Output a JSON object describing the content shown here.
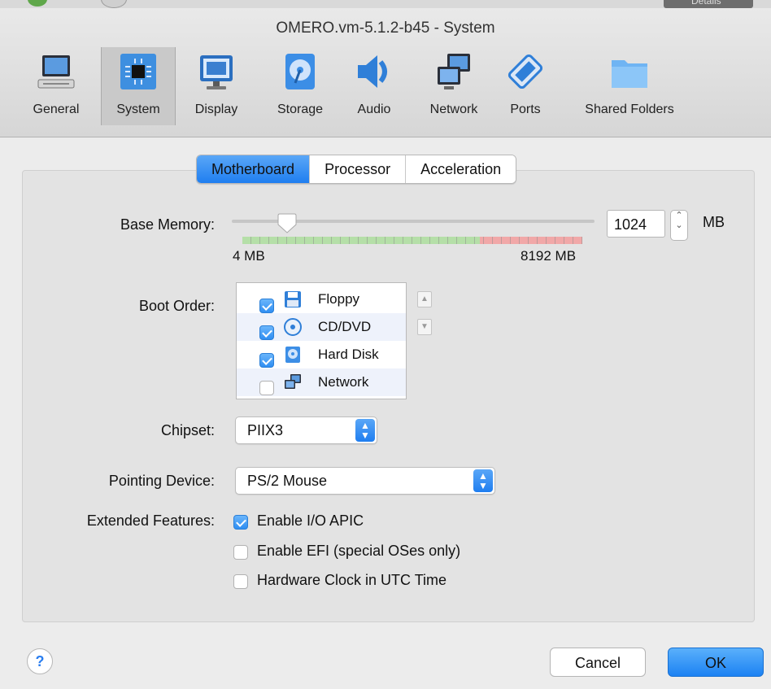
{
  "window": {
    "title": "OMERO.vm-5.1.2-b45 - System",
    "background_details_label": "Details"
  },
  "toolbar": {
    "items": [
      {
        "label": "General",
        "icon": "monitor-icon"
      },
      {
        "label": "System",
        "icon": "chip-icon",
        "selected": true
      },
      {
        "label": "Display",
        "icon": "display-icon"
      },
      {
        "label": "Storage",
        "icon": "disk-icon"
      },
      {
        "label": "Audio",
        "icon": "speaker-icon"
      },
      {
        "label": "Network",
        "icon": "network-icon"
      },
      {
        "label": "Ports",
        "icon": "plug-icon"
      },
      {
        "label": "Shared Folders",
        "icon": "folder-icon"
      }
    ]
  },
  "tabs": [
    {
      "label": "Motherboard",
      "active": true
    },
    {
      "label": "Processor"
    },
    {
      "label": "Acceleration"
    }
  ],
  "base_memory": {
    "label": "Base Memory:",
    "value": "1024",
    "unit": "MB",
    "min_label": "4 MB",
    "max_label": "8192 MB",
    "slider_fraction": 0.125
  },
  "boot_order": {
    "label": "Boot Order:",
    "items": [
      {
        "label": "Floppy",
        "checked": true,
        "icon": "floppy-icon"
      },
      {
        "label": "CD/DVD",
        "checked": true,
        "icon": "cd-icon"
      },
      {
        "label": "Hard Disk",
        "checked": true,
        "icon": "hard-disk-icon"
      },
      {
        "label": "Network",
        "checked": false,
        "icon": "network-icon"
      }
    ]
  },
  "chipset": {
    "label": "Chipset:",
    "value": "PIIX3"
  },
  "pointing_device": {
    "label": "Pointing Device:",
    "value": "PS/2 Mouse"
  },
  "extended_features": {
    "label": "Extended Features:",
    "items": [
      {
        "label": "Enable I/O APIC",
        "checked": true
      },
      {
        "label": "Enable EFI (special OSes only)",
        "checked": false
      },
      {
        "label": "Hardware Clock in UTC Time",
        "checked": false
      }
    ]
  },
  "buttons": {
    "help": "?",
    "cancel": "Cancel",
    "ok": "OK"
  },
  "colors": {
    "accent": "#1f7ef0",
    "memory_safe": "#b5dfa8",
    "memory_danger": "#f1a8a8"
  }
}
